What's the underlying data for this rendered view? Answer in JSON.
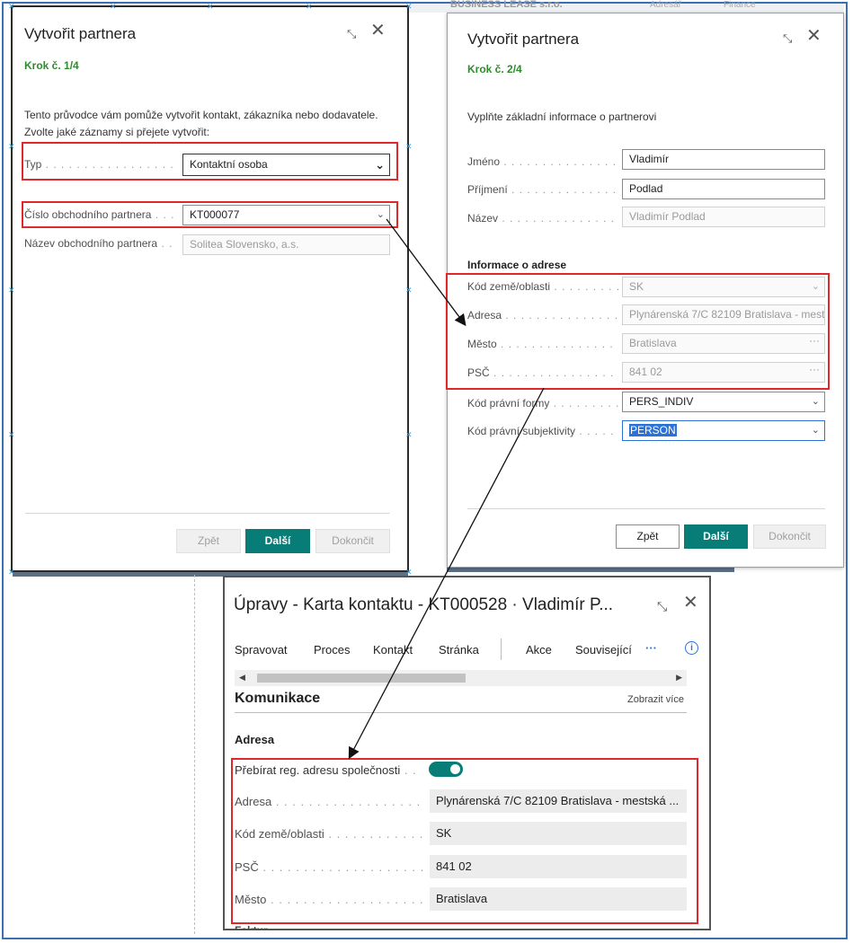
{
  "background": {
    "company_fragment": "BUSINESS LEASE s.r.o.",
    "tab_a": "Adresář",
    "tab_b": "Finance"
  },
  "wizard1": {
    "title": "Vytvořit partnera",
    "step": "Krok č. 1/4",
    "intro": "Tento průvodce vám pomůže vytvořit kontakt, zákazníka nebo dodavatele.",
    "prompt": "Zvolte jaké záznamy si přejete vytvořit:",
    "type_label": "Typ",
    "type_value": "Kontaktní osoba",
    "partner_no_label": "Číslo obchodního partnera",
    "partner_no_value": "KT000077",
    "partner_name_label": "Název obchodního partnera",
    "partner_name_value": "Solitea Slovensko, a.s.",
    "btn_back": "Zpět",
    "btn_next": "Další",
    "btn_finish": "Dokončit"
  },
  "wizard2": {
    "title": "Vytvořit partnera",
    "step": "Krok č. 2/4",
    "intro": "Vyplňte základní informace o partnerovi",
    "first_name_label": "Jméno",
    "first_name_value": "Vladimír",
    "last_name_label": "Příjmení",
    "last_name_value": "Podlad",
    "name_label": "Název",
    "name_value": "Vladimír Podlad",
    "address_section": "Informace o adrese",
    "country_label": "Kód země/oblasti",
    "country_value": "SK",
    "address_label": "Adresa",
    "address_value": "Plynárenská 7/C 82109 Bratislava - mestská",
    "city_label": "Město",
    "city_value": "Bratislava",
    "zip_label": "PSČ",
    "zip_value": "841 02",
    "legal_form_label": "Kód právní formy",
    "legal_form_value": "PERS_INDIV",
    "legal_subject_label": "Kód právní subjektivity",
    "legal_subject_value": "PERSON",
    "btn_back": "Zpět",
    "btn_next": "Další",
    "btn_finish": "Dokončit"
  },
  "card": {
    "title": "Úpravy - Karta kontaktu - KT000528 · Vladimír P...",
    "menu": [
      "Spravovat",
      "Proces",
      "Kontakt",
      "Stránka",
      "Akce",
      "Související"
    ],
    "more": "···",
    "section": "Komunikace",
    "show_more": "Zobrazit více",
    "address_group": "Adresa",
    "toggle_label": "Přebírat reg. adresu společnosti",
    "address_label": "Adresa",
    "address_value": "Plynárenská 7/C 82109 Bratislava - mestská ...",
    "country_label": "Kód země/oblasti",
    "country_value": "SK",
    "zip_label": "PSČ",
    "zip_value": "841 02",
    "city_label": "Město",
    "city_value": "Bratislava",
    "cut_label": "Faktur..."
  },
  "colors": {
    "accent": "#087d78",
    "step_green": "#2e8b2e",
    "highlight_red": "#e0282b",
    "frame_blue": "#3d6fb6"
  }
}
